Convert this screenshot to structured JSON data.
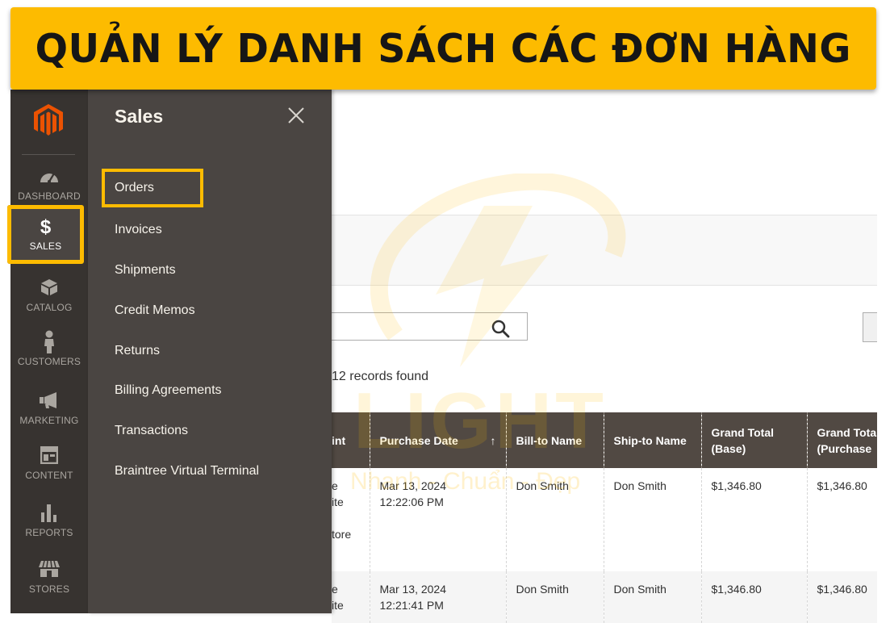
{
  "banner": {
    "title": "QUẢN LÝ DANH SÁCH CÁC ĐƠN HÀNG"
  },
  "nav": {
    "items": [
      {
        "label": "DASHBOARD",
        "icon": "dashboard-icon"
      },
      {
        "label": "SALES",
        "icon": "dollar-icon",
        "symbol": "$"
      },
      {
        "label": "CATALOG",
        "icon": "box-icon"
      },
      {
        "label": "CUSTOMERS",
        "icon": "person-icon"
      },
      {
        "label": "MARKETING",
        "icon": "megaphone-icon"
      },
      {
        "label": "CONTENT",
        "icon": "layout-icon"
      },
      {
        "label": "REPORTS",
        "icon": "bar-chart-icon"
      },
      {
        "label": "STORES",
        "icon": "storefront-icon"
      }
    ]
  },
  "flyout": {
    "title": "Sales",
    "items": [
      "Orders",
      "Invoices",
      "Shipments",
      "Credit Memos",
      "Returns",
      "Billing Agreements",
      "Transactions",
      "Braintree Virtual Terminal"
    ]
  },
  "grid": {
    "records": "12 records found",
    "columns": [
      "int",
      "Purchase Date",
      "Bill-to Name",
      "Ship-to Name",
      "Grand Total (Base)",
      "Grand Total (Purchased)"
    ],
    "column_lines": [
      [
        "int"
      ],
      [
        "Purchase Date"
      ],
      [
        "Bill-to Name"
      ],
      [
        "Ship-to Name"
      ],
      [
        "Grand Total",
        "(Base)"
      ],
      [
        "Grand Tota",
        "(Purchase"
      ]
    ],
    "sort_indicator": "↑",
    "rows": [
      {
        "col0": [
          "e",
          "ite",
          "",
          "tore"
        ],
        "date": "Mar 13, 2024",
        "time": "12:22:06 PM",
        "bill": "Don Smith",
        "ship": "Don Smith",
        "base": "$1,346.80",
        "purchased": "$1,346.80"
      },
      {
        "col0": [
          "e",
          "ite"
        ],
        "date": "Mar 13, 2024",
        "time": "12:21:41 PM",
        "bill": "Don Smith",
        "ship": "Don Smith",
        "base": "$1,346.80",
        "purchased": "$1,346.80"
      }
    ]
  },
  "watermark": {
    "text": "LIGHT",
    "sub": "Nhanh - Chuẩn - Đẹp"
  },
  "colors": {
    "accent": "#fdbb00",
    "nav_bg": "#373330",
    "flyout_bg": "#4a4542",
    "header_bg": "#514943",
    "brand": "#eb5202"
  }
}
